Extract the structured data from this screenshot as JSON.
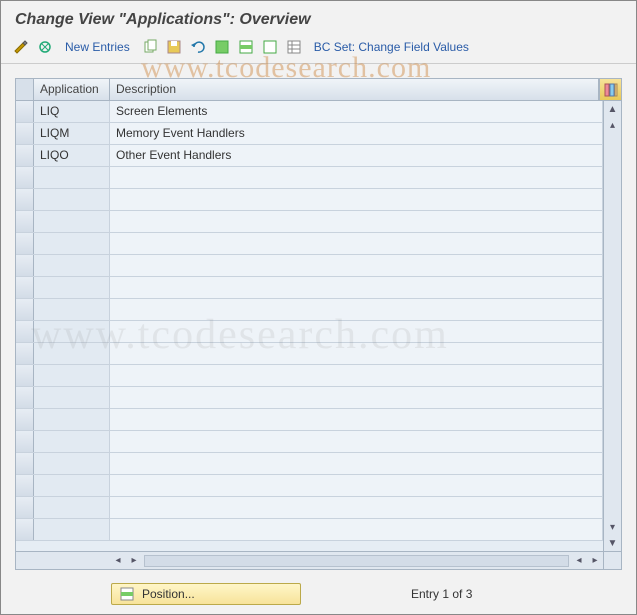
{
  "title": "Change View \"Applications\": Overview",
  "toolbar": {
    "new_entries": "New Entries",
    "bc_set": "BC Set: Change Field Values"
  },
  "grid": {
    "columns": {
      "application": "Application",
      "description": "Description"
    },
    "rows": [
      {
        "app": "LIQ",
        "desc": "Screen Elements"
      },
      {
        "app": "LIQM",
        "desc": "Memory Event Handlers"
      },
      {
        "app": "LIQO",
        "desc": "Other Event Handlers"
      }
    ],
    "empty_rows": 17
  },
  "footer": {
    "position_label": "Position...",
    "entry_text": "Entry 1 of 3"
  },
  "watermark": "www.tcodesearch.com"
}
